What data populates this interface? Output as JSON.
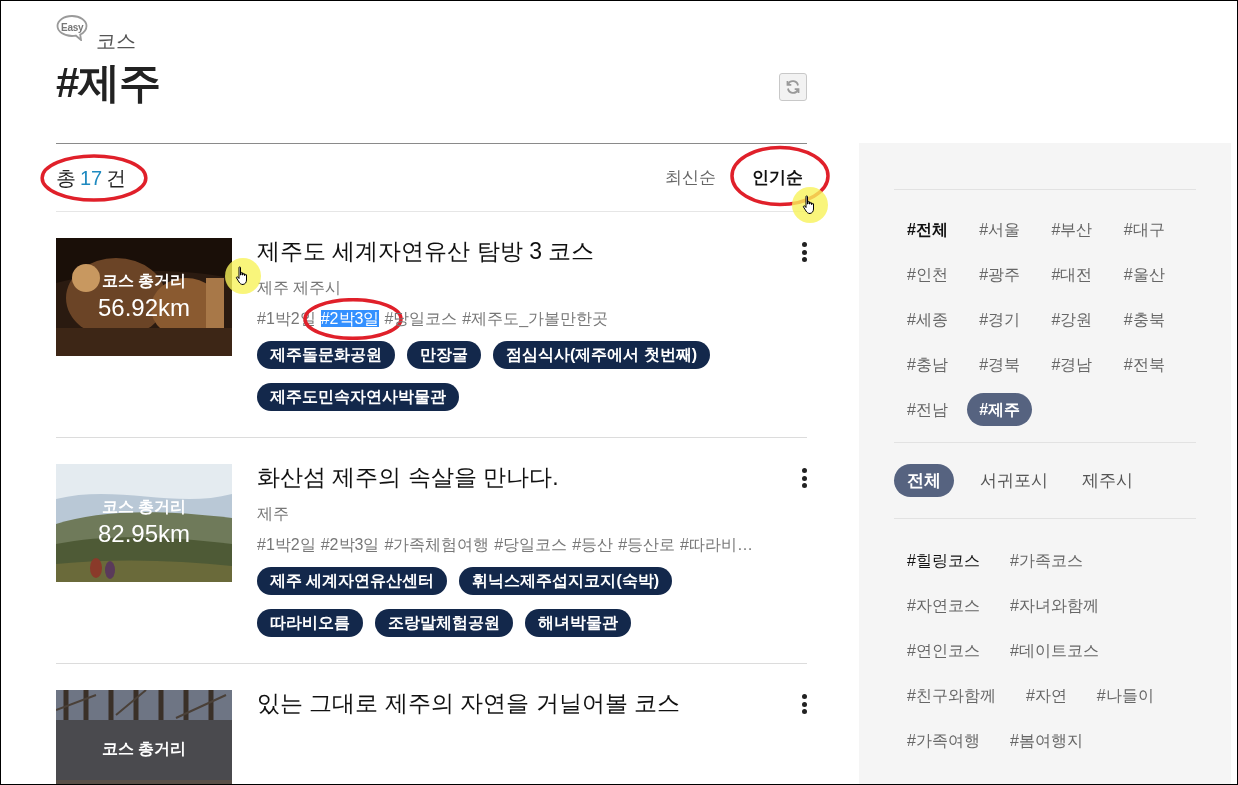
{
  "header": {
    "badge": "Easy",
    "category": "코스",
    "title": "#제주"
  },
  "count": {
    "prefix": "총",
    "number": "17",
    "suffix": "건",
    "circled": true
  },
  "sort_options": [
    {
      "label": "최신순",
      "selected": false,
      "circled": false,
      "cursor": false
    },
    {
      "label": "인기순",
      "selected": true,
      "circled": true,
      "cursor": true
    }
  ],
  "courses": [
    {
      "distance_label": "코스 총거리",
      "distance": "56.92km",
      "title": "제주도 세계자연유산 탐방 3 코스",
      "cursor": true,
      "region": "제주 제주시",
      "hashtags": [
        {
          "text": "#1박2일",
          "highlighted": false,
          "circled": false
        },
        {
          "text": "#2박3일",
          "highlighted": true,
          "circled": true
        },
        {
          "text": "#당일코스",
          "highlighted": false,
          "circled": false
        },
        {
          "text": "#제주도_가볼만한곳",
          "highlighted": false,
          "circled": false
        }
      ],
      "places": [
        "제주돌문화공원",
        "만장굴",
        "점심식사(제주에서 첫번째)",
        "제주도민속자연사박물관"
      ]
    },
    {
      "distance_label": "코스 총거리",
      "distance": "82.95km",
      "title": "화산섬 제주의 속살을 만나다.",
      "cursor": false,
      "region": "제주",
      "hashtags": [
        {
          "text": "#1박2일",
          "highlighted": false,
          "circled": false
        },
        {
          "text": "#2박3일",
          "highlighted": false,
          "circled": false
        },
        {
          "text": "#가족체험여행",
          "highlighted": false,
          "circled": false
        },
        {
          "text": "#당일코스",
          "highlighted": false,
          "circled": false
        },
        {
          "text": "#등산",
          "highlighted": false,
          "circled": false
        },
        {
          "text": "#등산로",
          "highlighted": false,
          "circled": false
        },
        {
          "text": "#따라비…",
          "highlighted": false,
          "circled": false
        }
      ],
      "places": [
        "제주 세계자연유산센터",
        "휘닉스제주섭지코지(숙박)",
        "따라비오름",
        "조랑말체험공원",
        "해녀박물관"
      ]
    },
    {
      "distance_label": "코스 총거리",
      "title": "있는 그대로 제주의 자연을 거닐어볼 코스",
      "cursor": false
    }
  ],
  "sidebar": {
    "regions": [
      {
        "label": "#전체",
        "kind": "all",
        "selected": false
      },
      {
        "label": "#서울",
        "kind": "area",
        "selected": false
      },
      {
        "label": "#부산",
        "kind": "area",
        "selected": false
      },
      {
        "label": "#대구",
        "kind": "area",
        "selected": false
      },
      {
        "label": "#인천",
        "kind": "area",
        "selected": false
      },
      {
        "label": "#광주",
        "kind": "area",
        "selected": false
      },
      {
        "label": "#대전",
        "kind": "area",
        "selected": false
      },
      {
        "label": "#울산",
        "kind": "area",
        "selected": false
      },
      {
        "label": "#세종",
        "kind": "area",
        "selected": false
      },
      {
        "label": "#경기",
        "kind": "area",
        "selected": false
      },
      {
        "label": "#강원",
        "kind": "area",
        "selected": false
      },
      {
        "label": "#충북",
        "kind": "area",
        "selected": false
      },
      {
        "label": "#충남",
        "kind": "area",
        "selected": false
      },
      {
        "label": "#경북",
        "kind": "area",
        "selected": false
      },
      {
        "label": "#경남",
        "kind": "area",
        "selected": false
      },
      {
        "label": "#전북",
        "kind": "area",
        "selected": false
      },
      {
        "label": "#전남",
        "kind": "area",
        "selected": false
      },
      {
        "label": "#제주",
        "kind": "area",
        "selected": true
      }
    ],
    "subregions": [
      {
        "label": "전체",
        "selected": true
      },
      {
        "label": "서귀포시",
        "selected": false
      },
      {
        "label": "제주시",
        "selected": false
      }
    ],
    "themes": [
      [
        {
          "label": "#힐링코스",
          "active": true
        },
        {
          "label": "#가족코스",
          "active": false
        }
      ],
      [
        {
          "label": "#자연코스",
          "active": false
        },
        {
          "label": "#자녀와함께",
          "active": false
        }
      ],
      [
        {
          "label": "#연인코스",
          "active": false
        },
        {
          "label": "#데이트코스",
          "active": false
        }
      ],
      [
        {
          "label": "#친구와함께",
          "active": false
        },
        {
          "label": "#자연",
          "active": false
        },
        {
          "label": "#나들이",
          "active": false
        }
      ],
      [
        {
          "label": "#가족여행",
          "active": false
        },
        {
          "label": "#봄여행지",
          "active": false
        }
      ]
    ]
  }
}
